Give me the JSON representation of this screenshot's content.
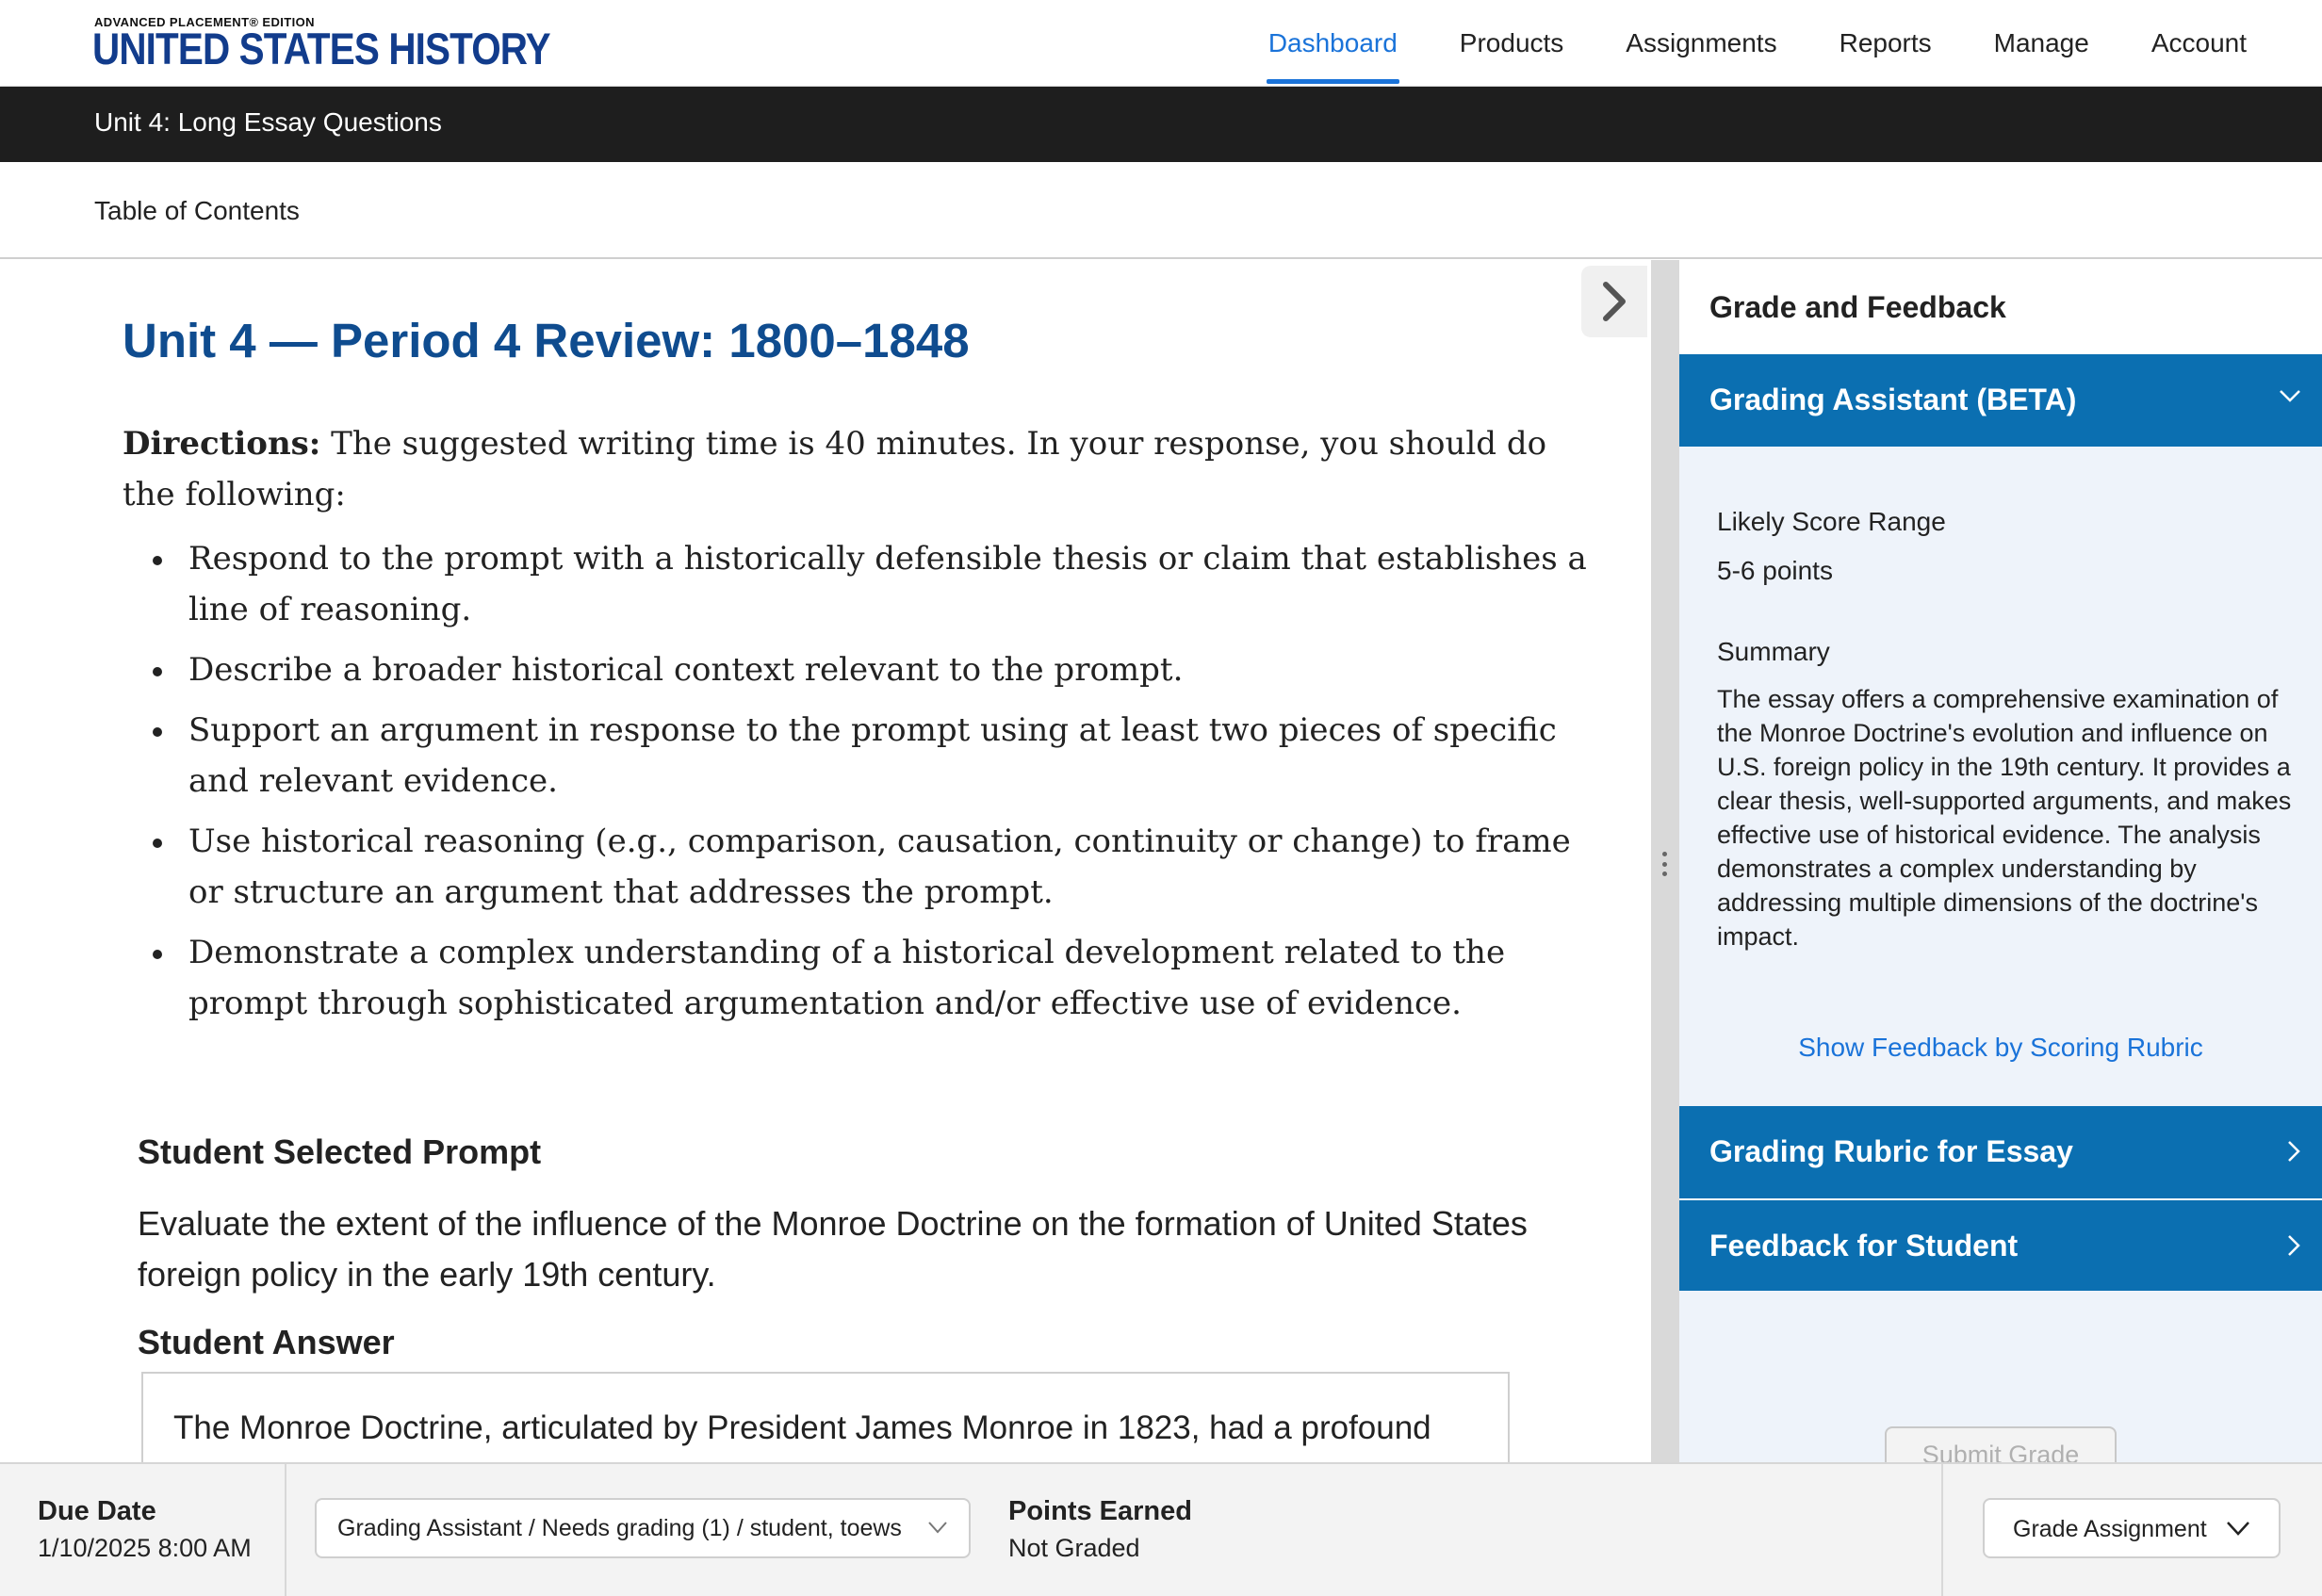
{
  "brand": {
    "small": "ADVANCED PLACEMENT® EDITION",
    "title": "UNITED STATES HISTORY"
  },
  "nav": {
    "items": [
      "Dashboard",
      "Products",
      "Assignments",
      "Reports",
      "Manage",
      "Account"
    ],
    "active": "Dashboard"
  },
  "unit_bar": {
    "title": "Unit 4: Long Essay Questions"
  },
  "toc": {
    "label": "Table of Contents"
  },
  "main": {
    "unit_title": "Unit 4 — Period 4 Review: 1800–1848",
    "directions_label": "Directions:",
    "directions_text": "The suggested writing time is 40 minutes. In your response, you should do the following:",
    "bullets": [
      "Respond to the prompt with a historically defensible thesis or claim that establishes a line of reasoning.",
      "Describe a broader historical context relevant to the prompt.",
      "Support an argument in response to the prompt using at least two pieces of specific and relevant evidence.",
      "Use historical reasoning (e.g., comparison, causation, continuity or change) to frame or structure an argument that addresses the prompt.",
      "Demonstrate a complex understanding of a historical development related to the prompt through sophisticated argumentation and/or effective use of evidence."
    ],
    "prompt_heading": "Student Selected Prompt",
    "prompt_text": "Evaluate the extent of the influence of the Monroe Doctrine on the formation of United States foreign policy in the early 19th century.",
    "answer_heading": "Student Answer",
    "answer_text": "The Monroe Doctrine, articulated by President James Monroe in 1823, had a profound"
  },
  "panel": {
    "heading": "Grade and Feedback",
    "grading_assistant": {
      "title": "Grading Assistant (BETA)",
      "score_label": "Likely Score Range",
      "score_value": "5-6 points",
      "summary_label": "Summary",
      "summary_text": "The essay offers a comprehensive examination of the Monroe Doctrine's evolution and influence on U.S. foreign policy in the 19th century. It provides a clear thesis, well-supported arguments, and makes effective use of historical evidence. The analysis demonstrates a complex understanding by addressing multiple dimensions of the doctrine's impact.",
      "link": "Show Feedback by Scoring Rubric"
    },
    "rubric": {
      "title": "Grading Rubric for Essay"
    },
    "feedback": {
      "title": "Feedback for Student"
    },
    "submit": "Submit Grade"
  },
  "bottom": {
    "due_label": "Due Date",
    "due_value": "1/10/2025 8:00 AM",
    "select_value": "Grading Assistant / Needs grading (1) / student, toews",
    "points_label": "Points Earned",
    "points_value": "Not Graded",
    "grade_button": "Grade Assignment"
  },
  "colors": {
    "accent": "#1a73d9",
    "panel_blue": "#0b6fb1",
    "title_blue": "#0f4c8f",
    "unit_bar": "#1e1e1e",
    "panel_bg": "#eef3fa"
  }
}
